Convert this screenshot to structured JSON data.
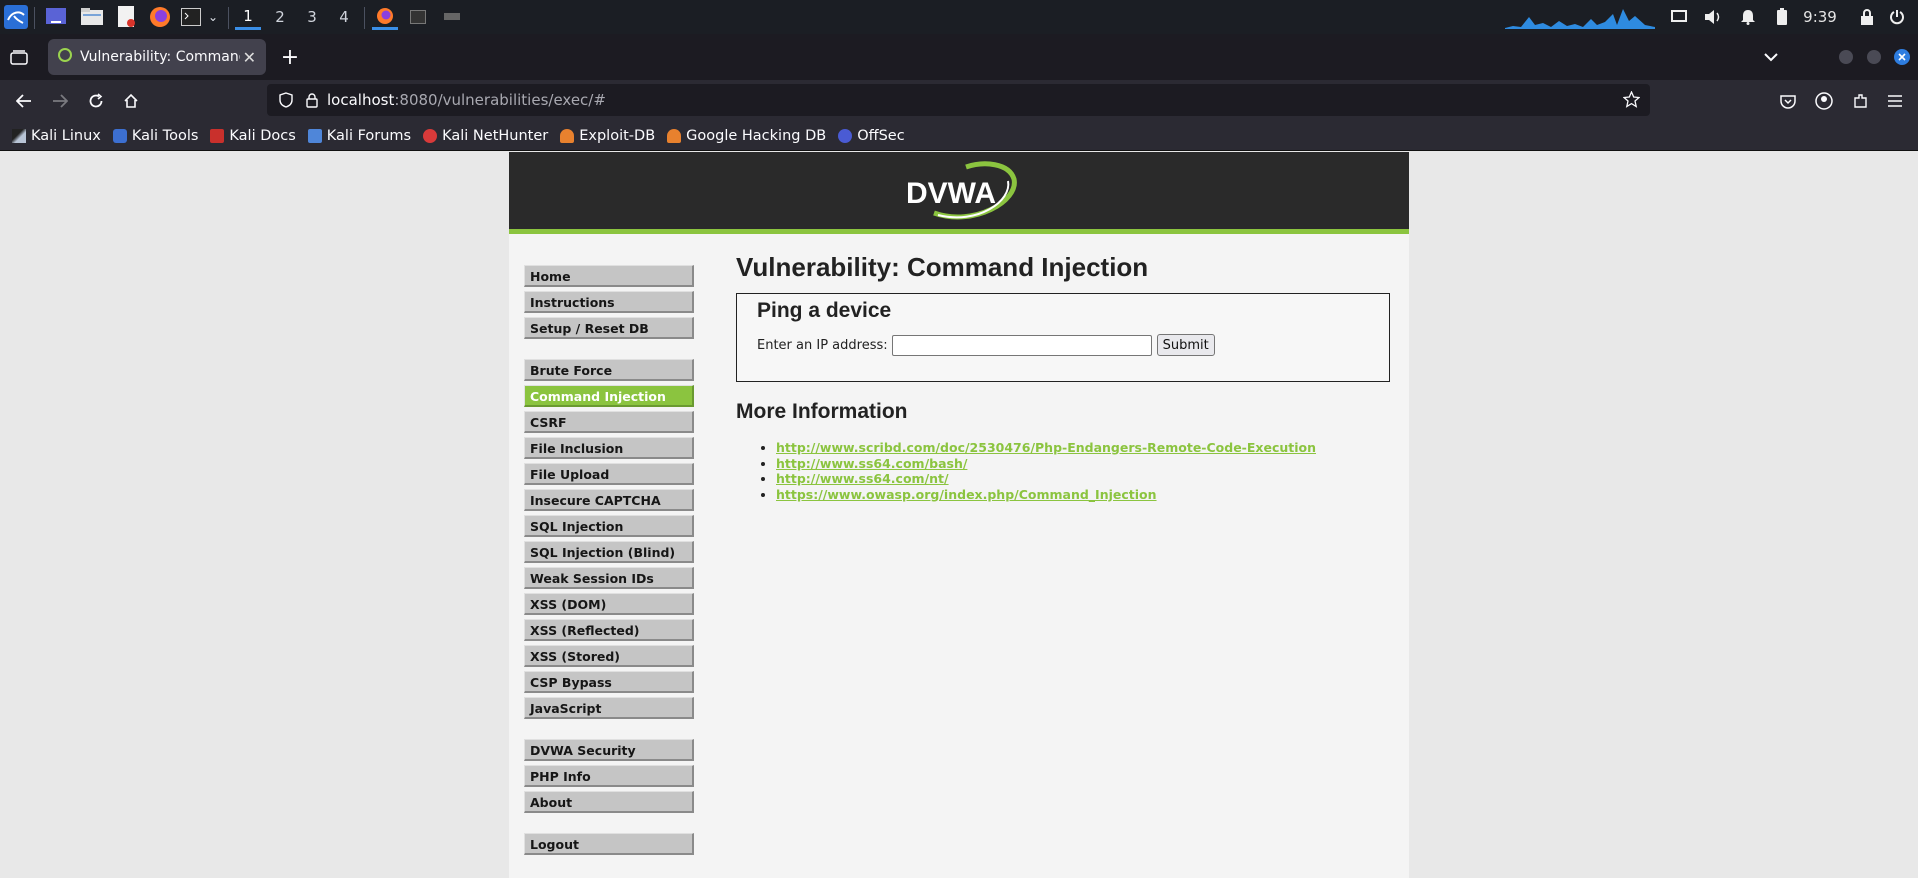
{
  "taskbar": {
    "workspaces": [
      "1",
      "2",
      "3",
      "4"
    ],
    "clock": "9:39"
  },
  "browser": {
    "tab_title": "Vulnerability: Command I",
    "url_host": "localhost",
    "url_rest": ":8080/vulnerabilities/exec/#",
    "bookmarks": [
      "Kali Linux",
      "Kali Tools",
      "Kali Docs",
      "Kali Forums",
      "Kali NetHunter",
      "Exploit-DB",
      "Google Hacking DB",
      "OffSec"
    ]
  },
  "dvwa": {
    "logo_text": "DVWA",
    "menu": {
      "group1": [
        "Home",
        "Instructions",
        "Setup / Reset DB"
      ],
      "group2": [
        "Brute Force",
        "Command Injection",
        "CSRF",
        "File Inclusion",
        "File Upload",
        "Insecure CAPTCHA",
        "SQL Injection",
        "SQL Injection (Blind)",
        "Weak Session IDs",
        "XSS (DOM)",
        "XSS (Reflected)",
        "XSS (Stored)",
        "CSP Bypass",
        "JavaScript"
      ],
      "group3": [
        "DVWA Security",
        "PHP Info",
        "About"
      ],
      "group4": [
        "Logout"
      ]
    },
    "page_title": "Vulnerability: Command Injection",
    "box_title": "Ping a device",
    "ip_label": "Enter an IP address:",
    "ip_value": "",
    "submit_label": "Submit",
    "more_info_title": "More Information",
    "links": [
      "http://www.scribd.com/doc/2530476/Php-Endangers-Remote-Code-Execution",
      "http://www.ss64.com/bash/",
      "http://www.ss64.com/nt/",
      "https://www.owasp.org/index.php/Command_Injection"
    ]
  },
  "colors": {
    "accent": "#8bc43f",
    "header": "#2a2a2a"
  }
}
